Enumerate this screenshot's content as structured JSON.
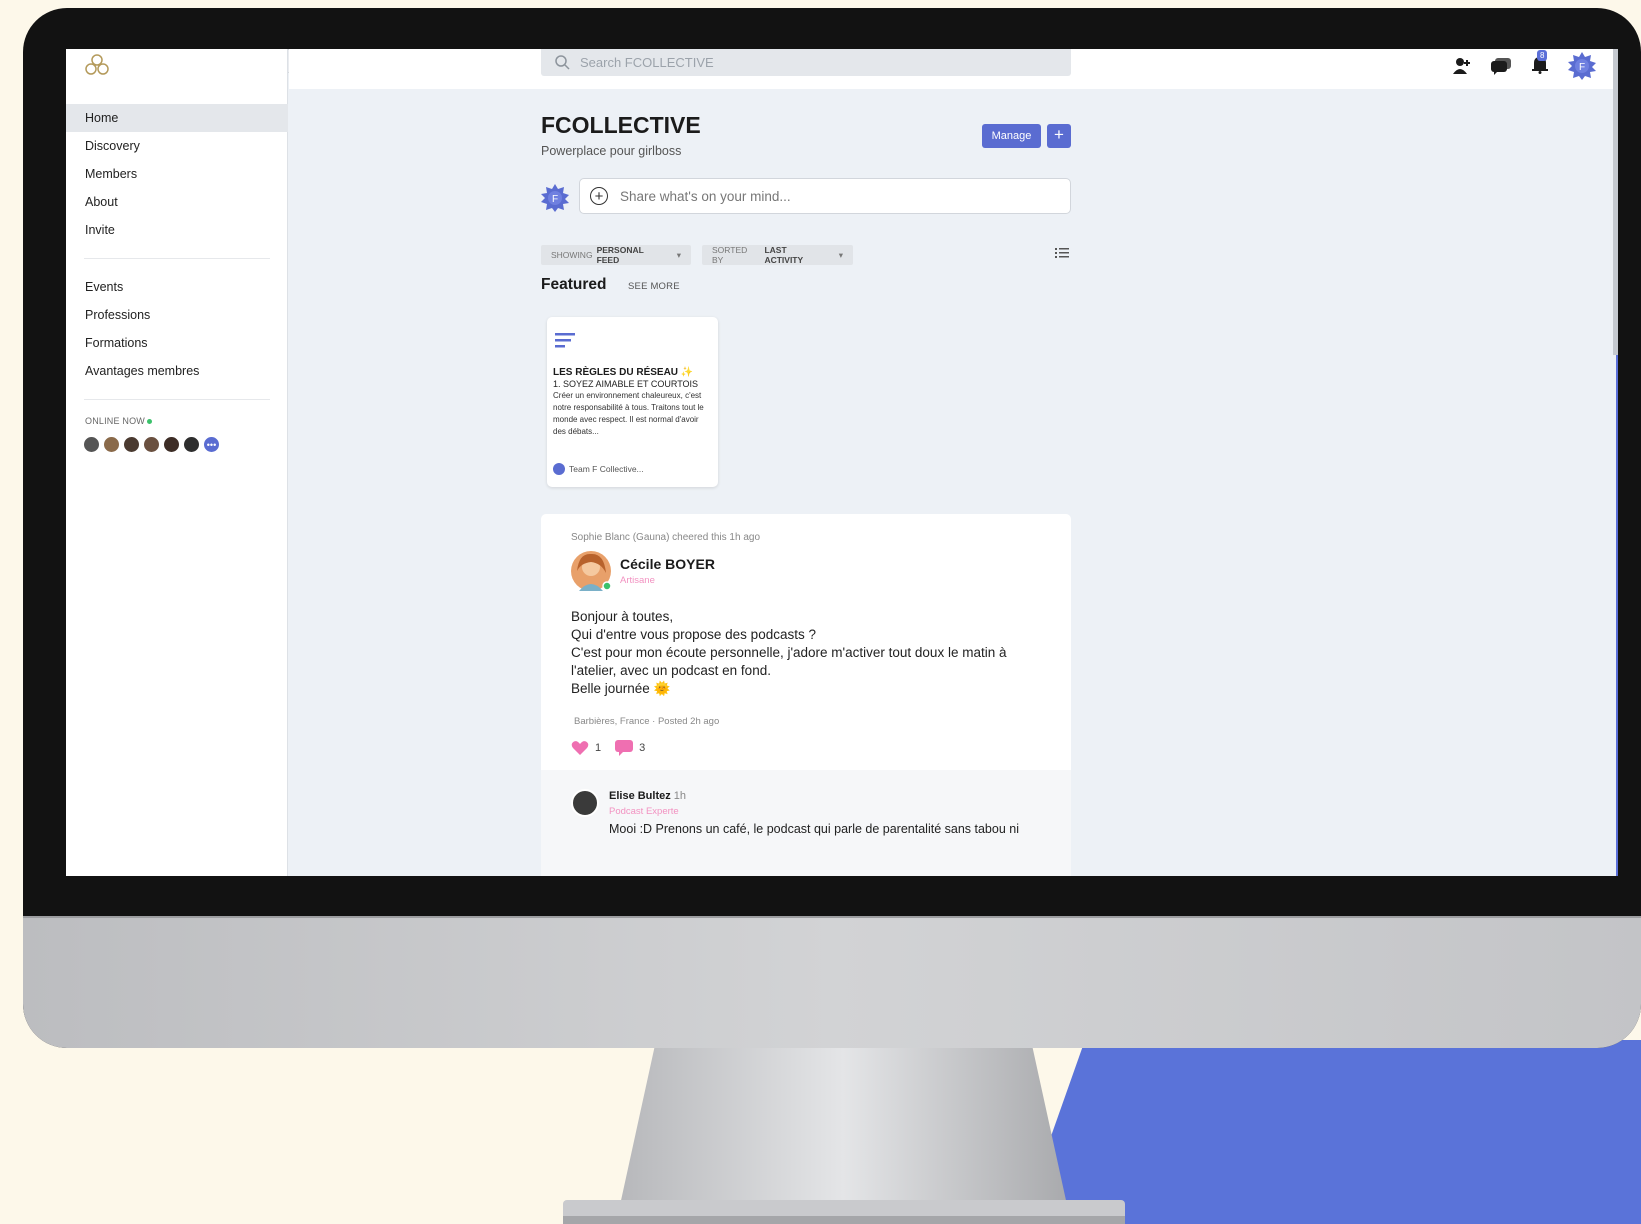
{
  "colors": {
    "background": "#fdf8ea",
    "brand_blue": "#5a6cd1",
    "accent_pink": "#f292c1",
    "online_green": "#3bc16b"
  },
  "search": {
    "placeholder": "Search FCOLLECTIVE"
  },
  "topbar": {
    "icons": [
      "add-user-icon",
      "chat-icon",
      "notification-bell-icon",
      "user-avatar"
    ],
    "notification_count": "8"
  },
  "sidebar": {
    "primary": [
      {
        "label": "Home",
        "active": true
      },
      {
        "label": "Discovery"
      },
      {
        "label": "Members"
      },
      {
        "label": "About"
      },
      {
        "label": "Invite"
      }
    ],
    "secondary": [
      {
        "label": "Events"
      },
      {
        "label": "Professions"
      },
      {
        "label": "Formations"
      },
      {
        "label": "Avantages membres"
      }
    ],
    "online_label": "ONLINE NOW"
  },
  "community": {
    "title": "FCOLLECTIVE",
    "subtitle": "Powerplace pour girlboss",
    "manage_label": "Manage",
    "add_label": "+"
  },
  "composer": {
    "placeholder": "Share what's on your mind..."
  },
  "filters": {
    "showing_prefix": "SHOWING",
    "showing_value": "PERSONAL FEED",
    "sorted_prefix": "SORTED BY",
    "sorted_value": "LAST ACTIVITY"
  },
  "featured": {
    "heading": "Featured",
    "see_more": "SEE MORE",
    "card": {
      "title": "LES RÈGLES DU RÉSEAU ✨",
      "line1": "1. SOYEZ AIMABLE ET COURTOIS",
      "body": "Créer un environnement chaleureux, c'est notre responsabilité à tous. Traitons tout le monde avec respect. Il est normal d'avoir des débats...",
      "author": "Team F Collective..."
    }
  },
  "post": {
    "cheer": "Sophie Blanc (Gauna) cheered this 1h ago",
    "author": "Cécile BOYER",
    "role": "Artisane",
    "lines": [
      "Bonjour à toutes,",
      "Qui d'entre vous propose des podcasts ?",
      "C'est pour mon écoute personnelle, j'adore m'activer tout doux le matin à l'atelier, avec un podcast en fond.",
      "Belle journée 🌞"
    ],
    "location": "Barbières, France",
    "posted": "Posted 2h ago",
    "likes": "1",
    "comments": "3"
  },
  "comment": {
    "author": "Elise Bultez",
    "time": "1h",
    "role": "Podcast Experte",
    "text": "Mooi :D Prenons un café, le podcast qui parle de parentalité sans tabou ni"
  }
}
